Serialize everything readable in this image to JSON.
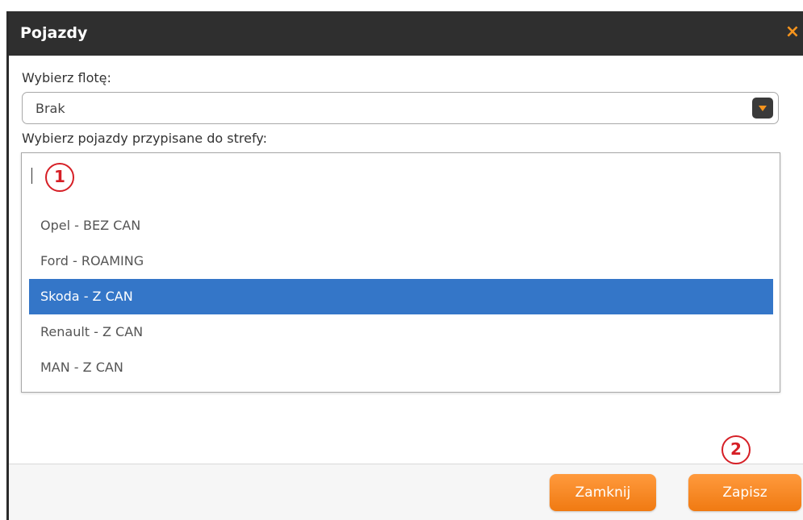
{
  "dialog": {
    "title": "Pojazdy",
    "close_icon": "×"
  },
  "fleet": {
    "label": "Wybierz flotę:",
    "selected": "Brak"
  },
  "vehicles": {
    "label": "Wybierz pojazdy przypisane do strefy:",
    "search_value": "",
    "options": [
      {
        "label": "Opel - BEZ CAN",
        "selected": false
      },
      {
        "label": "Ford - ROAMING",
        "selected": false
      },
      {
        "label": "Skoda - Z CAN",
        "selected": true
      },
      {
        "label": "Renault - Z CAN",
        "selected": false
      },
      {
        "label": "MAN - Z CAN",
        "selected": false
      }
    ]
  },
  "annotations": {
    "marker_1": "1",
    "marker_2": "2"
  },
  "footer": {
    "close_label": "Zamknij",
    "save_label": "Zapisz"
  },
  "colors": {
    "accent": "#f7941d",
    "titlebar": "#2f2f2f",
    "selection": "#3476c8",
    "marker": "#d61f26"
  }
}
